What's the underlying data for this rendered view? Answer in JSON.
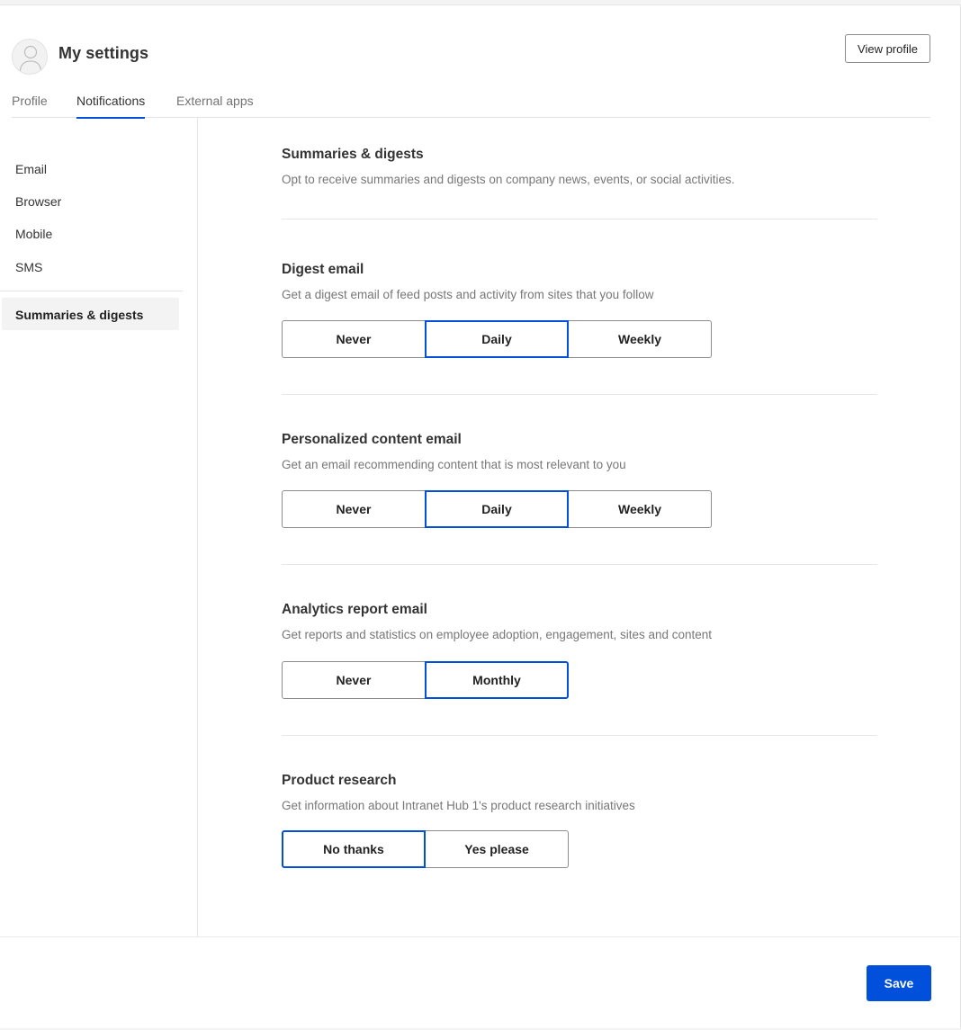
{
  "header": {
    "title": "My settings",
    "view_profile_label": "View profile",
    "avatar_icon": "user-placeholder-icon"
  },
  "tabs": [
    {
      "label": "Profile",
      "active": false
    },
    {
      "label": "Notifications",
      "active": true
    },
    {
      "label": "External apps",
      "active": false
    }
  ],
  "sidebar": {
    "items": [
      {
        "label": "Email"
      },
      {
        "label": "Browser"
      },
      {
        "label": "Mobile"
      },
      {
        "label": "SMS"
      }
    ],
    "active_item": {
      "label": "Summaries & digests"
    }
  },
  "main": {
    "intro": {
      "title": "Summaries & digests",
      "description": "Opt to receive summaries and digests on company news, events, or social activities."
    },
    "sections": [
      {
        "title": "Digest email",
        "description": "Get a digest email of feed posts and activity from sites that you follow",
        "options": [
          "Never",
          "Daily",
          "Weekly"
        ],
        "selected": "Daily"
      },
      {
        "title": "Personalized content email",
        "description": "Get an email recommending content that is most relevant to you",
        "options": [
          "Never",
          "Daily",
          "Weekly"
        ],
        "selected": "Daily"
      },
      {
        "title": "Analytics report email",
        "description": "Get reports and statistics on employee adoption, engagement, sites and content",
        "options": [
          "Never",
          "Monthly"
        ],
        "selected": "Monthly"
      },
      {
        "title": "Product research",
        "description": "Get information about Intranet Hub 1's product research initiatives",
        "options": [
          "No thanks",
          "Yes please"
        ],
        "selected": "No thanks"
      }
    ]
  },
  "footer": {
    "save_label": "Save"
  },
  "colors": {
    "accent": "#0050dc",
    "selected_border": "#0050d9",
    "active_sidebar_bg": "#f3f3f3"
  }
}
